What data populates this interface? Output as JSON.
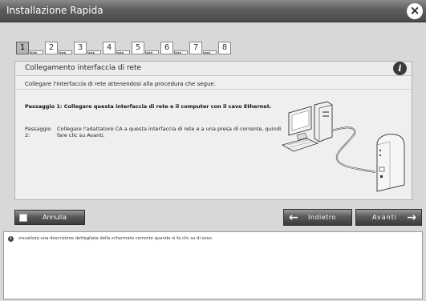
{
  "window": {
    "title": "Installazione Rapida",
    "close_symbol": "×"
  },
  "steps": [
    {
      "number": "1",
      "active": true
    },
    {
      "number": "2",
      "active": false
    },
    {
      "number": "3",
      "active": false
    },
    {
      "number": "4",
      "active": false
    },
    {
      "number": "5",
      "active": false
    },
    {
      "number": "6",
      "active": false
    },
    {
      "number": "7",
      "active": false
    },
    {
      "number": "8",
      "active": false
    }
  ],
  "step_dots": "▪▪▪",
  "panel": {
    "title": "Collegamento interfaccia di rete",
    "info_icon": "i",
    "intro": "Collegare l'interfaccia di rete attenendosi alla procedura che segue.",
    "step1": "Passaggio 1: Collegare questa interfaccia di rete e il computer con il cavo Ethernet.",
    "step2_label": "Passaggio 2:",
    "step2_text": "Collegare l'adattatore CA a questa interfaccia di rete e a una presa di corrente, quindi fare clic su Avanti."
  },
  "buttons": {
    "cancel": "Annulla",
    "back": "Indietro",
    "next": "Avanti",
    "back_arrow": "←",
    "next_arrow": "→"
  },
  "help": {
    "icon": "i",
    "text": "visualizza una descrizione dettagliata della schermata corrente quando si fa clic su di esso."
  },
  "colors": {
    "titlebar": "#5e5e5e",
    "panel_bg": "#efefef",
    "window_bg": "#d8d8d8"
  }
}
